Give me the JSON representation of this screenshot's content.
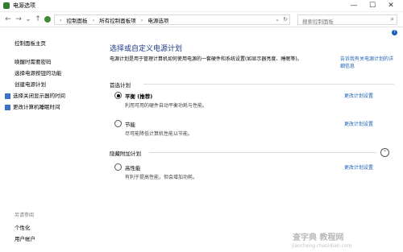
{
  "window": {
    "title": "电源选项",
    "minimize": "—",
    "maximize": "☐",
    "close": "✕"
  },
  "nav": {
    "back": "←",
    "forward": "→",
    "down": "⌄",
    "up": "↑",
    "breadcrumb": [
      "控制面板",
      "所有控制面板项",
      "电源选项"
    ],
    "separator": "›",
    "dropdown": "⌄",
    "refresh": "↻",
    "search_placeholder": "搜索控制面板",
    "search_icon": "⌕"
  },
  "sidebar": {
    "home": "控制面板主页",
    "items": [
      "唤醒时需要密码",
      "选择电源按钮的功能",
      "创建电源计划",
      "选择关闭显示器的时间",
      "更改计算机睡眠时间"
    ],
    "see_also_label": "另请参阅",
    "see_also_items": [
      "个性化",
      "用户帐户"
    ]
  },
  "main": {
    "heading": "选择或自定义电源计划",
    "description": "电源计划是用于管理计算机如何使用电源的一套硬件和系统设置(如显示器亮度、睡眠等)。",
    "description_link": "告诉我有关电源计划的详细信息",
    "preferred_label": "首选计划",
    "hidden_label": "隐藏附加计划",
    "collapse_icon": "⌃",
    "help_icon": "?",
    "plans": [
      {
        "name": "平衡 (推荐)",
        "desc": "利用可用的硬件自动平衡功耗与性能。",
        "selected": true,
        "change": "更改计划设置"
      },
      {
        "name": "节能",
        "desc": "尽可能降低计算机性能以节能。",
        "selected": false,
        "change": "更改计划设置"
      },
      {
        "name": "高性能",
        "desc": "有利于提高性能，但会增加功耗。",
        "selected": false,
        "change": "更改计划设置"
      }
    ]
  },
  "watermark": {
    "line1": "查字典 教程网",
    "line2": "jiaocheng.chazidian.com"
  },
  "colors": {
    "link": "#1a5fb4",
    "heading": "#1e3a8a"
  }
}
